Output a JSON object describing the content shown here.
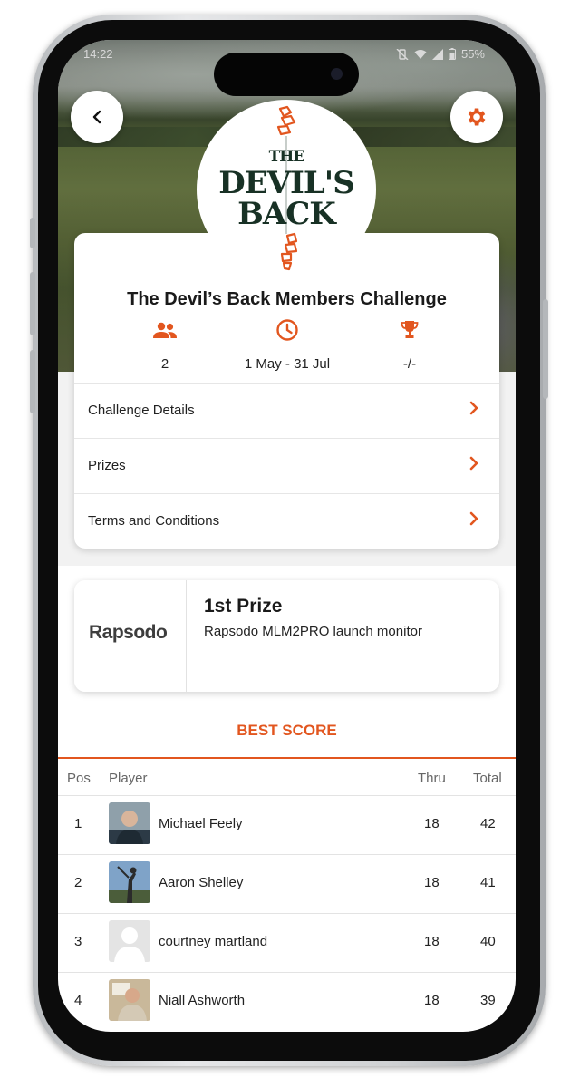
{
  "status": {
    "time": "14:22",
    "battery": "55%"
  },
  "logo": {
    "line1": "THE",
    "line2": "DEVIL'S",
    "line3": "BACK"
  },
  "challenge": {
    "title": "The Devil’s Back Members Challenge",
    "stats": [
      {
        "icon": "people-icon",
        "value": "2"
      },
      {
        "icon": "clock-icon",
        "value": "1 May - 31 Jul"
      },
      {
        "icon": "trophy-icon",
        "value": "-/-"
      }
    ],
    "menu": [
      {
        "label": "Challenge Details"
      },
      {
        "label": "Prizes"
      },
      {
        "label": "Terms and Conditions"
      }
    ]
  },
  "prize": {
    "brand": "Rapsodo",
    "title": "1st Prize",
    "description": "Rapsodo MLM2PRO launch monitor"
  },
  "leaderboard": {
    "heading": "BEST SCORE",
    "columns": {
      "pos": "Pos",
      "player": "Player",
      "thru": "Thru",
      "total": "Total"
    },
    "rows": [
      {
        "pos": "1",
        "player": "Michael Feely",
        "thru": "18",
        "total": "42"
      },
      {
        "pos": "2",
        "player": "Aaron Shelley",
        "thru": "18",
        "total": "41"
      },
      {
        "pos": "3",
        "player": "courtney martland",
        "thru": "18",
        "total": "40"
      },
      {
        "pos": "4",
        "player": "Niall Ashworth",
        "thru": "18",
        "total": "39"
      }
    ]
  },
  "colors": {
    "accent": "#e2561f",
    "logo_green": "#183125"
  }
}
